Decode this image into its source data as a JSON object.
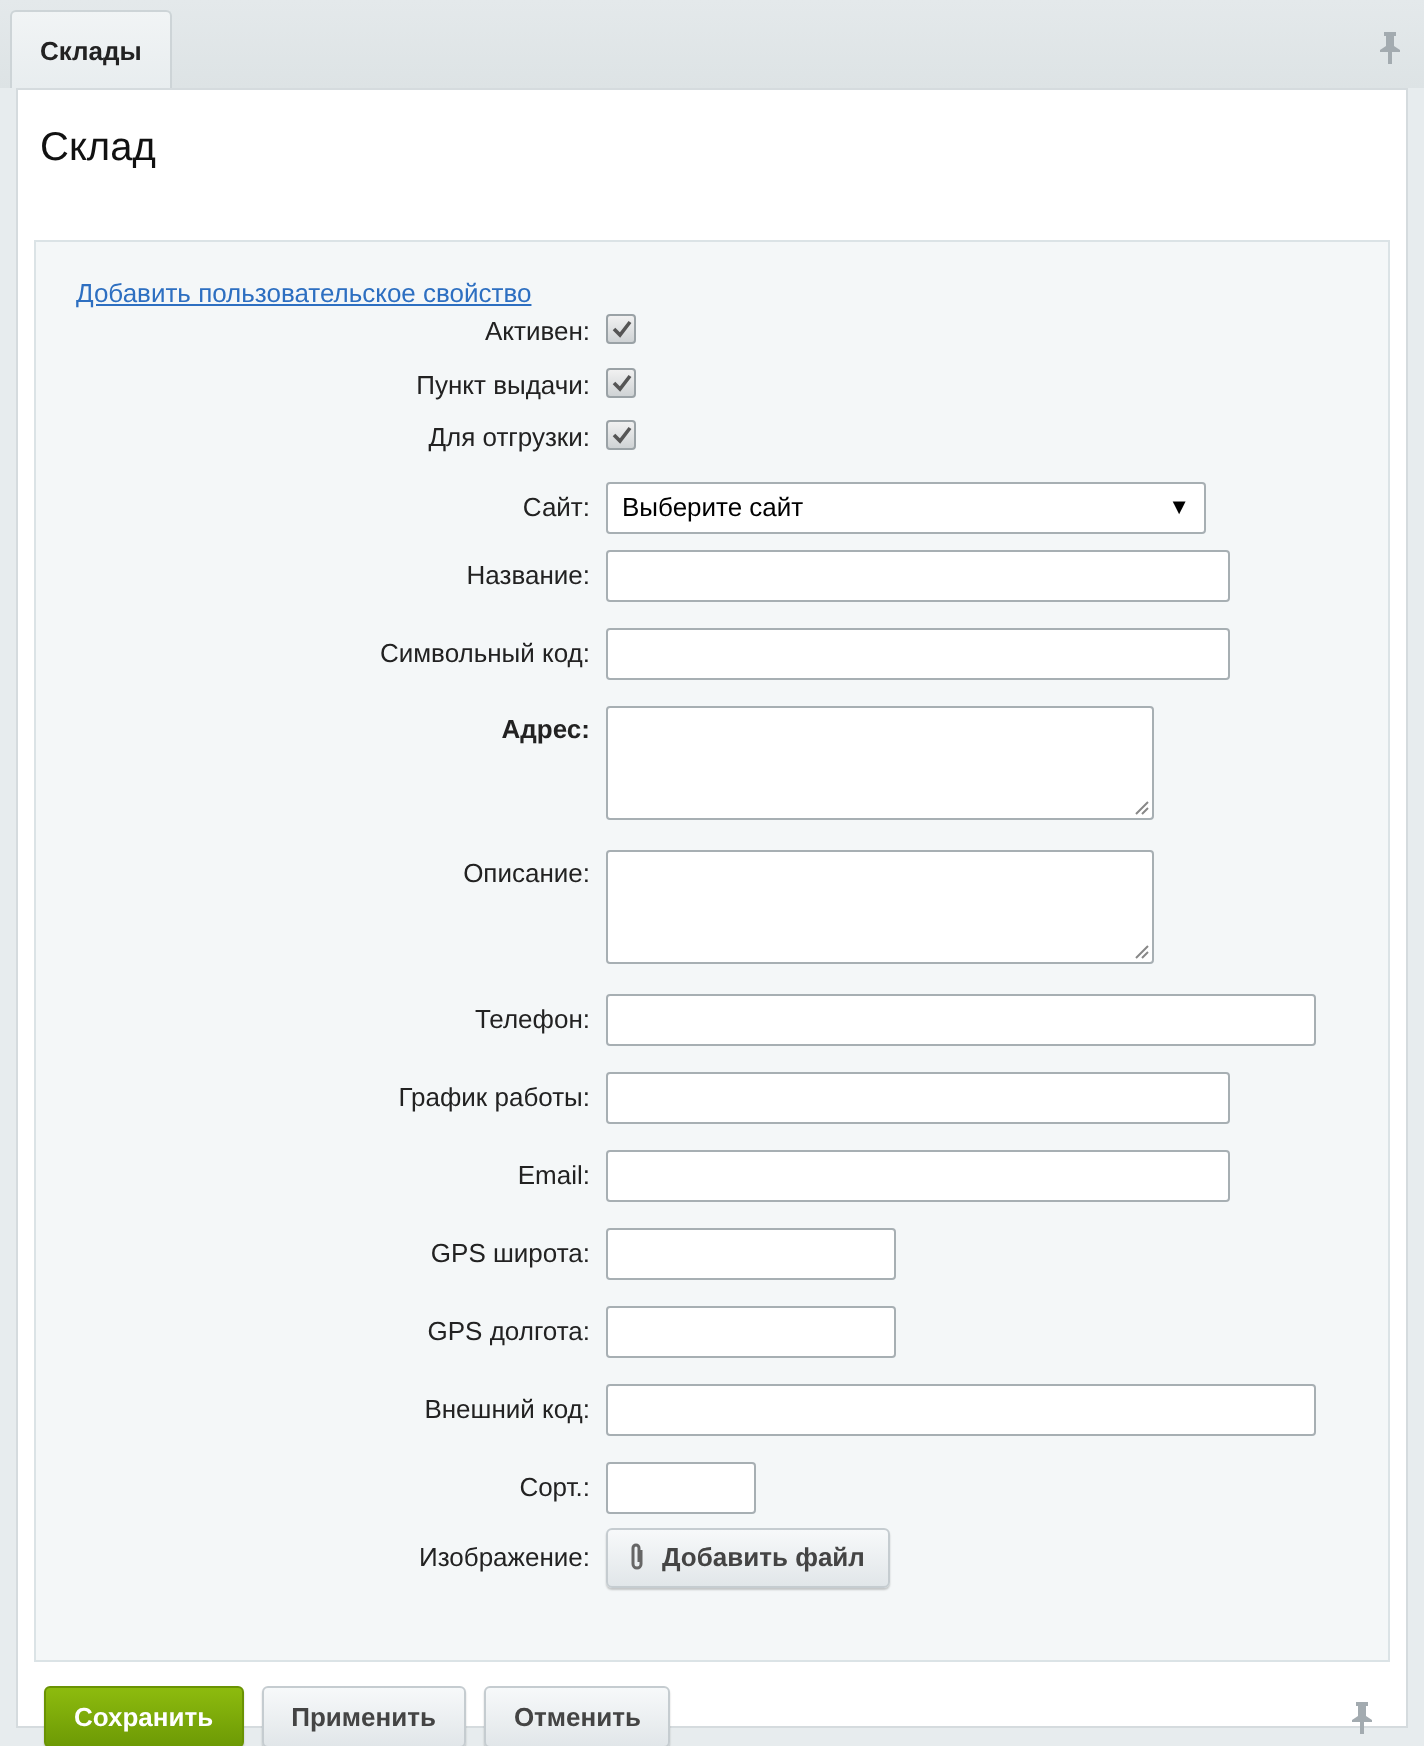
{
  "tabs": [
    {
      "label": "Склады",
      "selected": true
    }
  ],
  "heading": "Склад",
  "add_property_link": "Добавить пользовательское свойство",
  "fields": [
    {
      "kind": "checkbox",
      "label": "Активен:",
      "required": false,
      "checked": true
    },
    {
      "kind": "checkbox",
      "label": "Пункт выдачи:",
      "required": false,
      "checked": true
    },
    {
      "kind": "checkbox",
      "label": "Для отгрузки:",
      "required": false,
      "checked": true
    },
    {
      "kind": "select",
      "label": "Сайт:",
      "required": false,
      "value": "Выберите сайт",
      "arrow": "▼"
    },
    {
      "kind": "text",
      "label": "Название:",
      "required": false
    },
    {
      "kind": "text",
      "label": "Символьный код:",
      "required": false
    },
    {
      "kind": "textarea",
      "label": "Адрес:",
      "required": true
    },
    {
      "kind": "textarea",
      "label": "Описание:",
      "required": false
    },
    {
      "kind": "text",
      "label": "Телефон:",
      "required": false
    },
    {
      "kind": "text",
      "label": "График работы:",
      "required": false
    },
    {
      "kind": "text",
      "label": "Email:",
      "required": false
    },
    {
      "kind": "text",
      "label": "GPS широта:",
      "required": false
    },
    {
      "kind": "text",
      "label": "GPS долгота:",
      "required": false
    },
    {
      "kind": "text",
      "label": "Внешний код:",
      "required": false
    },
    {
      "kind": "text",
      "label": "Сорт.:",
      "required": false
    },
    {
      "kind": "file",
      "label": "Изображение:",
      "required": false,
      "button": "Добавить файл"
    }
  ],
  "buttons": [
    {
      "label": "Сохранить",
      "kind": "primary"
    },
    {
      "label": "Применить",
      "kind": "normal"
    },
    {
      "label": "Отменить",
      "kind": "normal"
    }
  ]
}
